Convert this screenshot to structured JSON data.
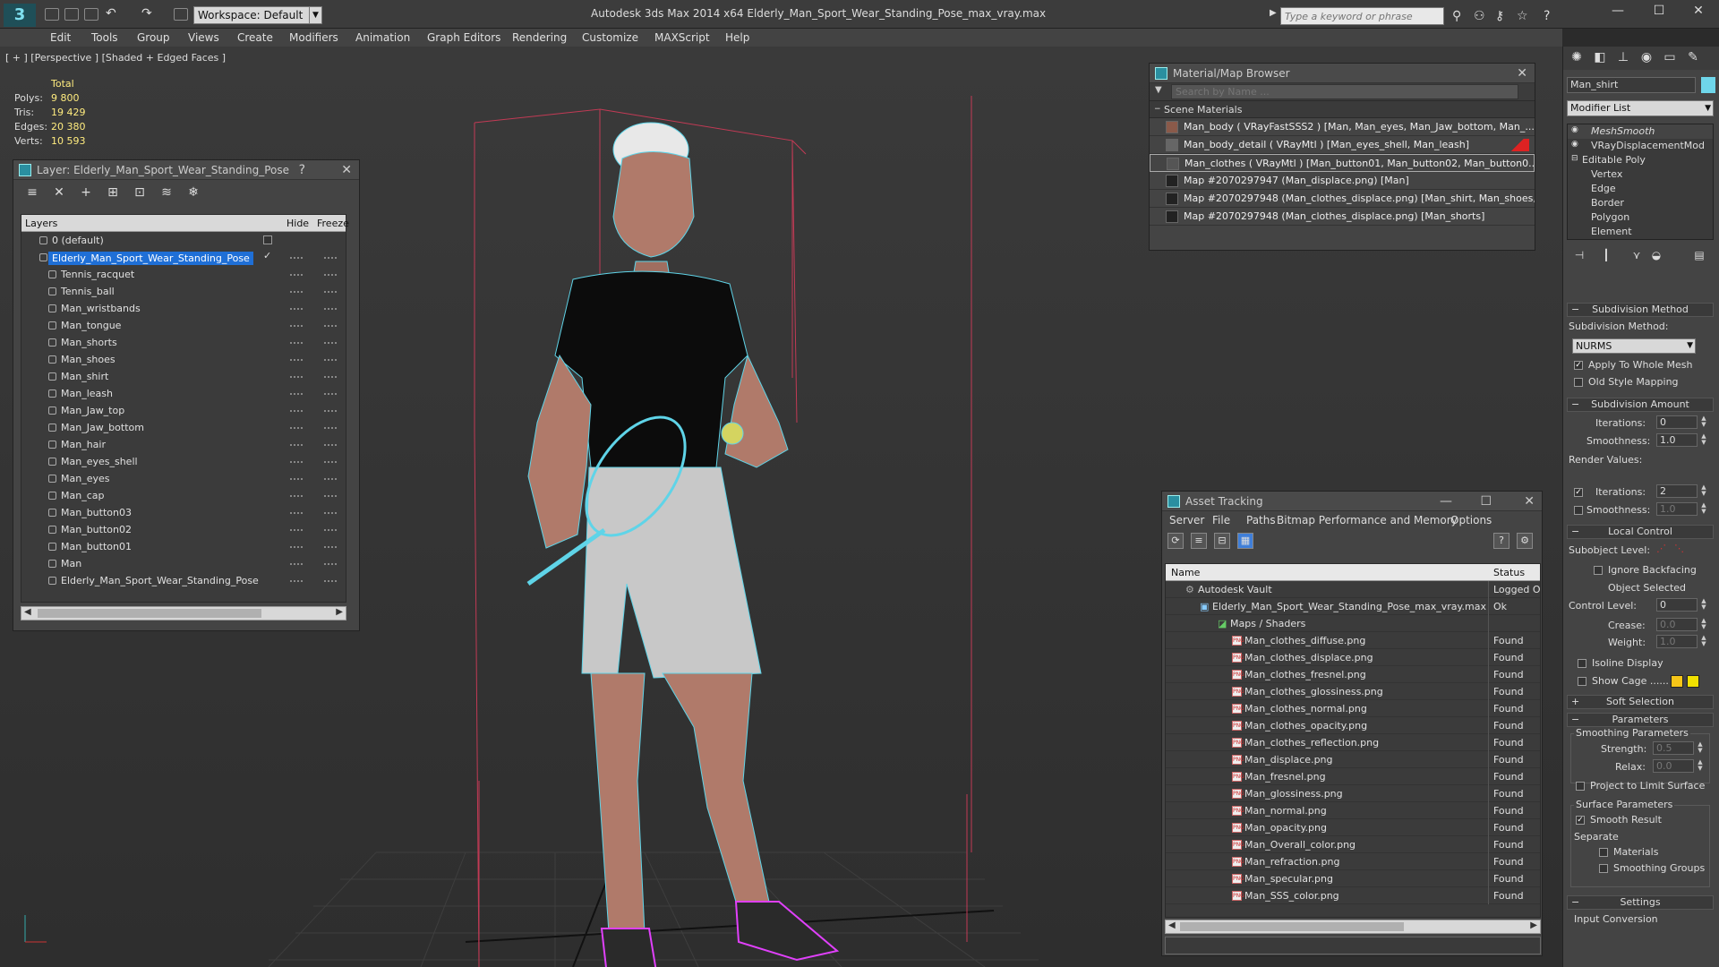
{
  "titlebar": {
    "logo": "3",
    "workspace_label": "Workspace: Default",
    "app_title": "Autodesk 3ds Max  2014 x64      Elderly_Man_Sport_Wear_Standing_Pose_max_vray.max",
    "search_placeholder": "Type a keyword or phrase"
  },
  "menu": [
    "Edit",
    "Tools",
    "Group",
    "Views",
    "Create",
    "Modifiers",
    "Animation",
    "Graph Editors",
    "Rendering",
    "Customize",
    "MAXScript",
    "Help"
  ],
  "viewport": {
    "label": "[ + ] [Perspective ] [Shaded + Edged Faces ]",
    "stats": {
      "total_label": "Total",
      "rows": [
        {
          "label": "Polys:",
          "value": "9 800"
        },
        {
          "label": "Tris:",
          "value": "19 429"
        },
        {
          "label": "Edges:",
          "value": "20 380"
        },
        {
          "label": "Verts:",
          "value": "10 593"
        }
      ]
    }
  },
  "layer_panel": {
    "title": "Layer: Elderly_Man_Sport_Wear_Standing_Pose",
    "help": "?",
    "close": "✕",
    "col_layers": "Layers",
    "col_hide": "Hide",
    "col_freeze": "Freeze",
    "default_layer": "0 (default)",
    "selected_layer": "Elderly_Man_Sport_Wear_Standing_Pose",
    "objects": [
      "Tennis_racquet",
      "Tennis_ball",
      "Man_wristbands",
      "Man_tongue",
      "Man_shorts",
      "Man_shoes",
      "Man_shirt",
      "Man_leash",
      "Man_Jaw_top",
      "Man_Jaw_bottom",
      "Man_hair",
      "Man_eyes_shell",
      "Man_eyes",
      "Man_cap",
      "Man_button03",
      "Man_button02",
      "Man_button01",
      "Man",
      "Elderly_Man_Sport_Wear_Standing_Pose"
    ]
  },
  "material_browser": {
    "title": "Material/Map Browser",
    "close": "✕",
    "search_placeholder": "Search by Name ...",
    "section": "Scene Materials",
    "items": [
      "Man_body  ( VRayFastSSS2 ) [Man, Man_eyes, Man_Jaw_bottom, Man_...",
      "Man_body_detail  ( VRayMtl ) [Man_eyes_shell, Man_leash]",
      "Man_clothes  ( VRayMtl ) [Man_button01, Man_button02, Man_button0...",
      "Map #2070297947 (Man_displace.png)  [Man]",
      "Map #2070297948 (Man_clothes_displace.png)  [Man_shirt, Man_shoes,...",
      "Map #2070297948 (Man_clothes_displace.png)  [Man_shorts]"
    ]
  },
  "asset_tracking": {
    "title": "Asset Tracking",
    "menu": [
      "Server",
      "File",
      "Paths",
      "Bitmap Performance and Memory",
      "Options"
    ],
    "col_name": "Name",
    "col_status": "Status",
    "vault": {
      "name": "Autodesk Vault",
      "status": "Logged O"
    },
    "file": {
      "name": "Elderly_Man_Sport_Wear_Standing_Pose_max_vray.max",
      "status": "Ok"
    },
    "group": "Maps / Shaders",
    "png_tag": "PNG",
    "found": "Found",
    "maps": [
      "Man_clothes_diffuse.png",
      "Man_clothes_displace.png",
      "Man_clothes_fresnel.png",
      "Man_clothes_glossiness.png",
      "Man_clothes_normal.png",
      "Man_clothes_opacity.png",
      "Man_clothes_reflection.png",
      "Man_displace.png",
      "Man_fresnel.png",
      "Man_glossiness.png",
      "Man_normal.png",
      "Man_opacity.png",
      "Man_Overall_color.png",
      "Man_refraction.png",
      "Man_specular.png",
      "Man_SSS_color.png"
    ]
  },
  "command_panel": {
    "object_name": "Man_shirt",
    "modifier_list": "Modifier List",
    "stack": [
      {
        "name": "MeshSmooth",
        "level": 0
      },
      {
        "name": "VRayDisplacementMod",
        "level": 0
      },
      {
        "name": "Editable Poly",
        "level": 0
      },
      {
        "name": "Vertex",
        "level": 1
      },
      {
        "name": "Edge",
        "level": 1
      },
      {
        "name": "Border",
        "level": 1
      },
      {
        "name": "Polygon",
        "level": 1
      },
      {
        "name": "Element",
        "level": 1
      }
    ],
    "subdivision_method": {
      "header": "Subdivision Method",
      "label": "Subdivision Method:",
      "value": "NURMS",
      "apply_whole_mesh": "Apply To Whole Mesh",
      "old_style_mapping": "Old Style Mapping"
    },
    "subdivision_amount": {
      "header": "Subdivision Amount",
      "iterations_label": "Iterations:",
      "iterations": "0",
      "smoothness_label": "Smoothness:",
      "smoothness": "1.0",
      "render_values": "Render Values:",
      "render_iterations_label": "Iterations:",
      "render_iterations": "2",
      "render_smoothness_label": "Smoothness:",
      "render_smoothness": "1.0"
    },
    "local_control": {
      "header": "Local Control",
      "subobject_level": "Subobject Level:",
      "ignore_backfacing": "Ignore Backfacing",
      "object_selected": "Object Selected",
      "control_level_label": "Control Level:",
      "control_level": "0",
      "crease_label": "Crease:",
      "crease": "0.0",
      "weight_label": "Weight:",
      "weight": "1.0",
      "isoline_display": "Isoline Display",
      "show_cage": "Show Cage ......",
      "cage_color_1": "#f5c518",
      "cage_color_2": "#f0e000"
    },
    "soft_selection": {
      "header": "Soft Selection"
    },
    "parameters": {
      "header": "Parameters",
      "smoothing_params": "Smoothing Parameters",
      "strength_label": "Strength:",
      "strength": "0.5",
      "relax_label": "Relax:",
      "relax": "0.0",
      "project_limit": "Project to Limit Surface",
      "surface_params": "Surface Parameters",
      "smooth_result": "Smooth Result",
      "separate": "Separate",
      "materials": "Materials",
      "smoothing_groups": "Smoothing Groups"
    },
    "settings": {
      "header": "Settings",
      "input_conversion": "Input Conversion"
    }
  },
  "colors": {
    "accent_select": "#1f6fd6",
    "wire": "#5fd4e8",
    "shoes": "#e040fb",
    "stats": "#ffec7f"
  }
}
